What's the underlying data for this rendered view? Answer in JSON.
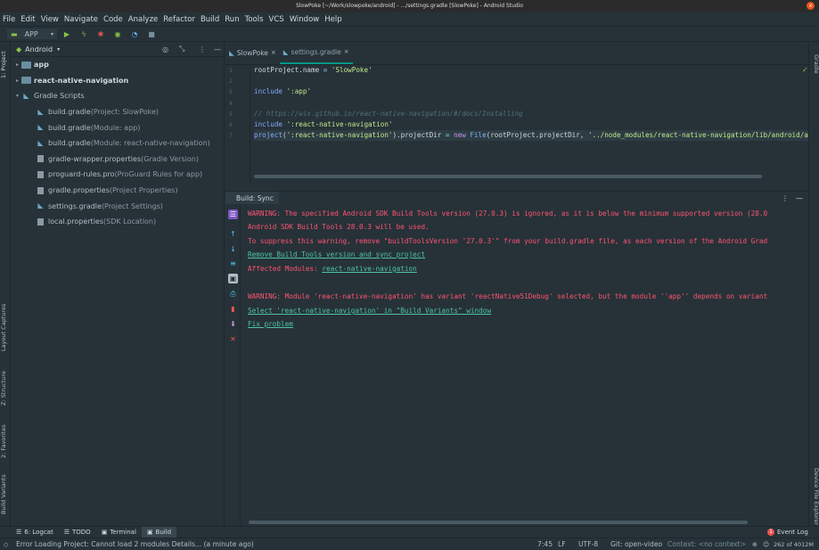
{
  "window": {
    "title": "SlowPoke [~/Work/slowpoke/android] - .../settings.gradle [SlowPoke] - Android Studio",
    "close": "x"
  },
  "menu": [
    "File",
    "Edit",
    "View",
    "Navigate",
    "Code",
    "Analyze",
    "Refactor",
    "Build",
    "Run",
    "Tools",
    "VCS",
    "Window",
    "Help"
  ],
  "toolbar": {
    "config": "APP"
  },
  "project": {
    "view": "Android",
    "tree": [
      {
        "label": "app",
        "detail": "",
        "depth": 0,
        "arrow": "▸",
        "icon": "folder",
        "bold": true
      },
      {
        "label": "react-native-navigation",
        "detail": "",
        "depth": 0,
        "arrow": "▸",
        "icon": "folder",
        "bold": true
      },
      {
        "label": "Gradle Scripts",
        "detail": "",
        "depth": 0,
        "arrow": "▾",
        "icon": "gradle",
        "bold": false
      },
      {
        "label": "build.gradle",
        "detail": " (Project: SlowPoke)",
        "depth": 1,
        "arrow": "",
        "icon": "gradle"
      },
      {
        "label": "build.gradle",
        "detail": " (Module: app)",
        "depth": 1,
        "arrow": "",
        "icon": "gradle"
      },
      {
        "label": "build.gradle",
        "detail": " (Module: react-native-navigation)",
        "depth": 1,
        "arrow": "",
        "icon": "gradle"
      },
      {
        "label": "gradle-wrapper.properties",
        "detail": " (Gradle Version)",
        "depth": 1,
        "arrow": "",
        "icon": "file"
      },
      {
        "label": "proguard-rules.pro",
        "detail": " (ProGuard Rules for app)",
        "depth": 1,
        "arrow": "",
        "icon": "file"
      },
      {
        "label": "gradle.properties",
        "detail": " (Project Properties)",
        "depth": 1,
        "arrow": "",
        "icon": "file"
      },
      {
        "label": "settings.gradle",
        "detail": " (Project Settings)",
        "depth": 1,
        "arrow": "",
        "icon": "gradle"
      },
      {
        "label": "local.properties",
        "detail": " (SDK Location)",
        "depth": 1,
        "arrow": "",
        "icon": "file"
      }
    ]
  },
  "sidetabs": {
    "project": "1: Project",
    "layout": "Layout Captures",
    "structure": "Z: Structure",
    "favorites": "2: Favorites",
    "variants": "Build Variants",
    "gradle": "Gradle",
    "device": "Device File Explorer"
  },
  "editor": {
    "tabs": [
      {
        "label": "SlowPoke"
      },
      {
        "label": "settings.gradle"
      }
    ],
    "line_numbers": [
      "1",
      "2",
      "3",
      "4",
      "5",
      "6",
      "7"
    ]
  },
  "build": {
    "tab": "Build: Sync",
    "lines": [
      {
        "text": "WARNING: The specified Android SDK Build Tools version (27.0.3) is ignored, as it is below the minimum supported version (28.0",
        "type": "warn"
      },
      {
        "text": "Android SDK Build Tools 28.0.3 will be used.",
        "type": "warn"
      },
      {
        "text": "To suppress this warning, remove \"buildToolsVersion '27.0.3'\" from your build.gradle file, as each version of the Android Grad",
        "type": "warn"
      },
      {
        "text": "Remove Build Tools version and sync project",
        "type": "link"
      },
      {
        "text": "Affected Modules: ",
        "type": "warn",
        "link": "react-native-navigation"
      },
      {
        "text": "",
        "type": "blank"
      },
      {
        "text": "WARNING: Module 'react-native-navigation' has variant 'reactNative51Debug' selected, but the module ''app'' depends on variant",
        "type": "warn"
      },
      {
        "text": "Select 'react-native-navigation' in \"Build Variants\" window",
        "type": "link"
      },
      {
        "text": "Fix problem",
        "type": "link"
      }
    ]
  },
  "bottom_tabs": [
    {
      "label": "6: Logcat",
      "icon": "☰"
    },
    {
      "label": "TODO",
      "icon": "☰"
    },
    {
      "label": "Terminal",
      "icon": "▣"
    },
    {
      "label": "Build",
      "icon": "▣"
    }
  ],
  "event_log": "Event Log",
  "event_badge": "1",
  "status": {
    "message": "Error Loading Project: Cannot load 2 modules Details... (a minute ago)",
    "position": "7:45",
    "line_sep": "LF",
    "encoding": "UTF-8",
    "git": "Git: open-video",
    "context": "Context: <no context>",
    "memory": "262 of 4012M"
  }
}
